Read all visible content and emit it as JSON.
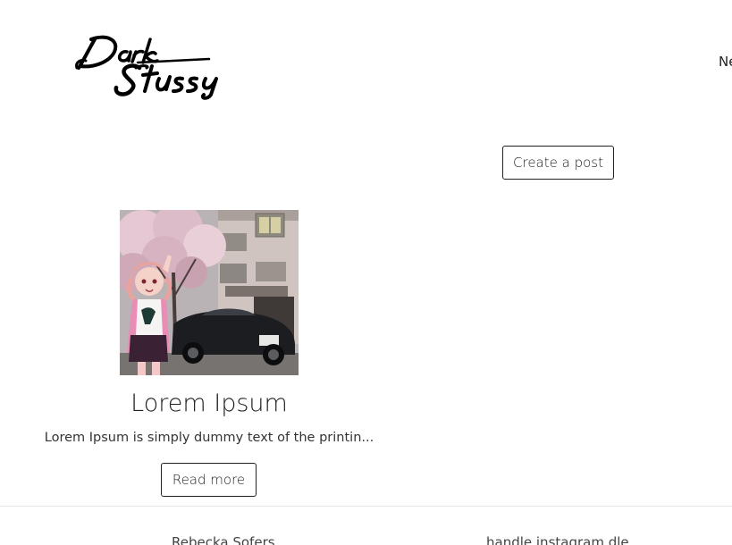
{
  "header": {
    "logo_text": "Dark Stussy",
    "nav_link": "Ne"
  },
  "actions": {
    "create_post_label": "Create a post"
  },
  "posts": [
    {
      "title": "Lorem Ipsum",
      "excerpt": "Lorem Ipsum is simply dummy text of the printin...",
      "read_more_label": "Read more"
    }
  ],
  "footer": {
    "left_text": "Rebecka Sofers",
    "right_text": "handle instagram dle"
  },
  "colors": {
    "text": "#222222",
    "border": "#222222",
    "divider": "#e5e5e5",
    "background": "#ffffff"
  }
}
